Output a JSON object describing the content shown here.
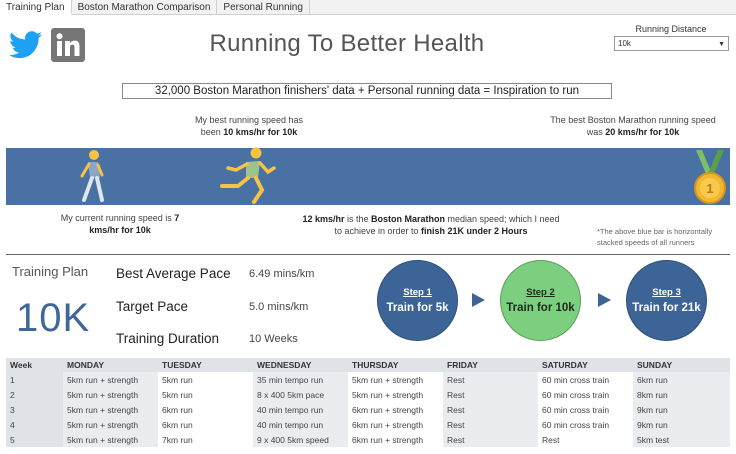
{
  "tabs": [
    "Training Plan",
    "Boston Marathon Comparison",
    "Personal Running"
  ],
  "social": {
    "twitter": "twitter-icon",
    "linkedin": "linkedin-icon"
  },
  "title": "Running To Better Health",
  "distance": {
    "label": "Running Distance",
    "value": "10k"
  },
  "banner": "32,000 Boston Marathon finishers' data + Personal running data = Inspiration to run",
  "notes": {
    "best_pre": "My best running speed has been ",
    "best_bold": "10 kms/hr for 10k",
    "boston_pre": "The best Boston Marathon running speed was ",
    "boston_bold": "20 kms/hr for 10k",
    "current_pre": "My current running speed is ",
    "current_bold": "7 kms/hr for 10k",
    "median_b1": "12 kms/hr",
    "median_t1": " is the ",
    "median_b2": "Boston Marathon",
    "median_t2": " median speed; which I need to achieve in order to ",
    "median_b3": "finish 21K under 2 Hours",
    "footnote": "*The above blue bar is horizontally stacked speeds of all runners"
  },
  "training": {
    "label": "Training Plan",
    "distance": "10K",
    "best_pace_label": "Best Average Pace",
    "best_pace": "6.49 mins/km",
    "target_pace_label": "Target Pace",
    "target_pace": "5.0 mins/km",
    "duration_label": "Training Duration",
    "duration": "10 Weeks"
  },
  "steps": [
    {
      "label": "Step 1",
      "text": "Train for 5k"
    },
    {
      "label": "Step 2",
      "text": "Train for 10k"
    },
    {
      "label": "Step 3",
      "text": "Train for 21k"
    }
  ],
  "table": {
    "headers": [
      "Week",
      "MONDAY",
      "TUESDAY",
      "WEDNESDAY",
      "THURSDAY",
      "FRIDAY",
      "SATURDAY",
      "SUNDAY"
    ],
    "rows": [
      [
        "1",
        "5km run + strength",
        "5km run",
        "35 min tempo run",
        "5km run + strength",
        "Rest",
        "60 min cross train",
        "6km run"
      ],
      [
        "2",
        "5km run + strength",
        "5km run",
        "8 x 400 5km pace",
        "5km run + strength",
        "Rest",
        "60 min cross train",
        "8km run"
      ],
      [
        "3",
        "5km run + strength",
        "6km run",
        "40 min tempo run",
        "6km run + strength",
        "Rest",
        "60 min cross train",
        "9km run"
      ],
      [
        "4",
        "5km run + strength",
        "6km run",
        "40 min tempo run",
        "6km run + strength",
        "Rest",
        "60 min cross train",
        "9km run"
      ],
      [
        "5",
        "5km run + strength",
        "7km run",
        "9 x 400 5km speed",
        "6km run + strength",
        "Rest",
        "Rest",
        "5km test"
      ]
    ]
  },
  "colors": {
    "bar": "#4a71a3",
    "step_blue": "#3d6496",
    "step_green": "#7ccf7e"
  }
}
